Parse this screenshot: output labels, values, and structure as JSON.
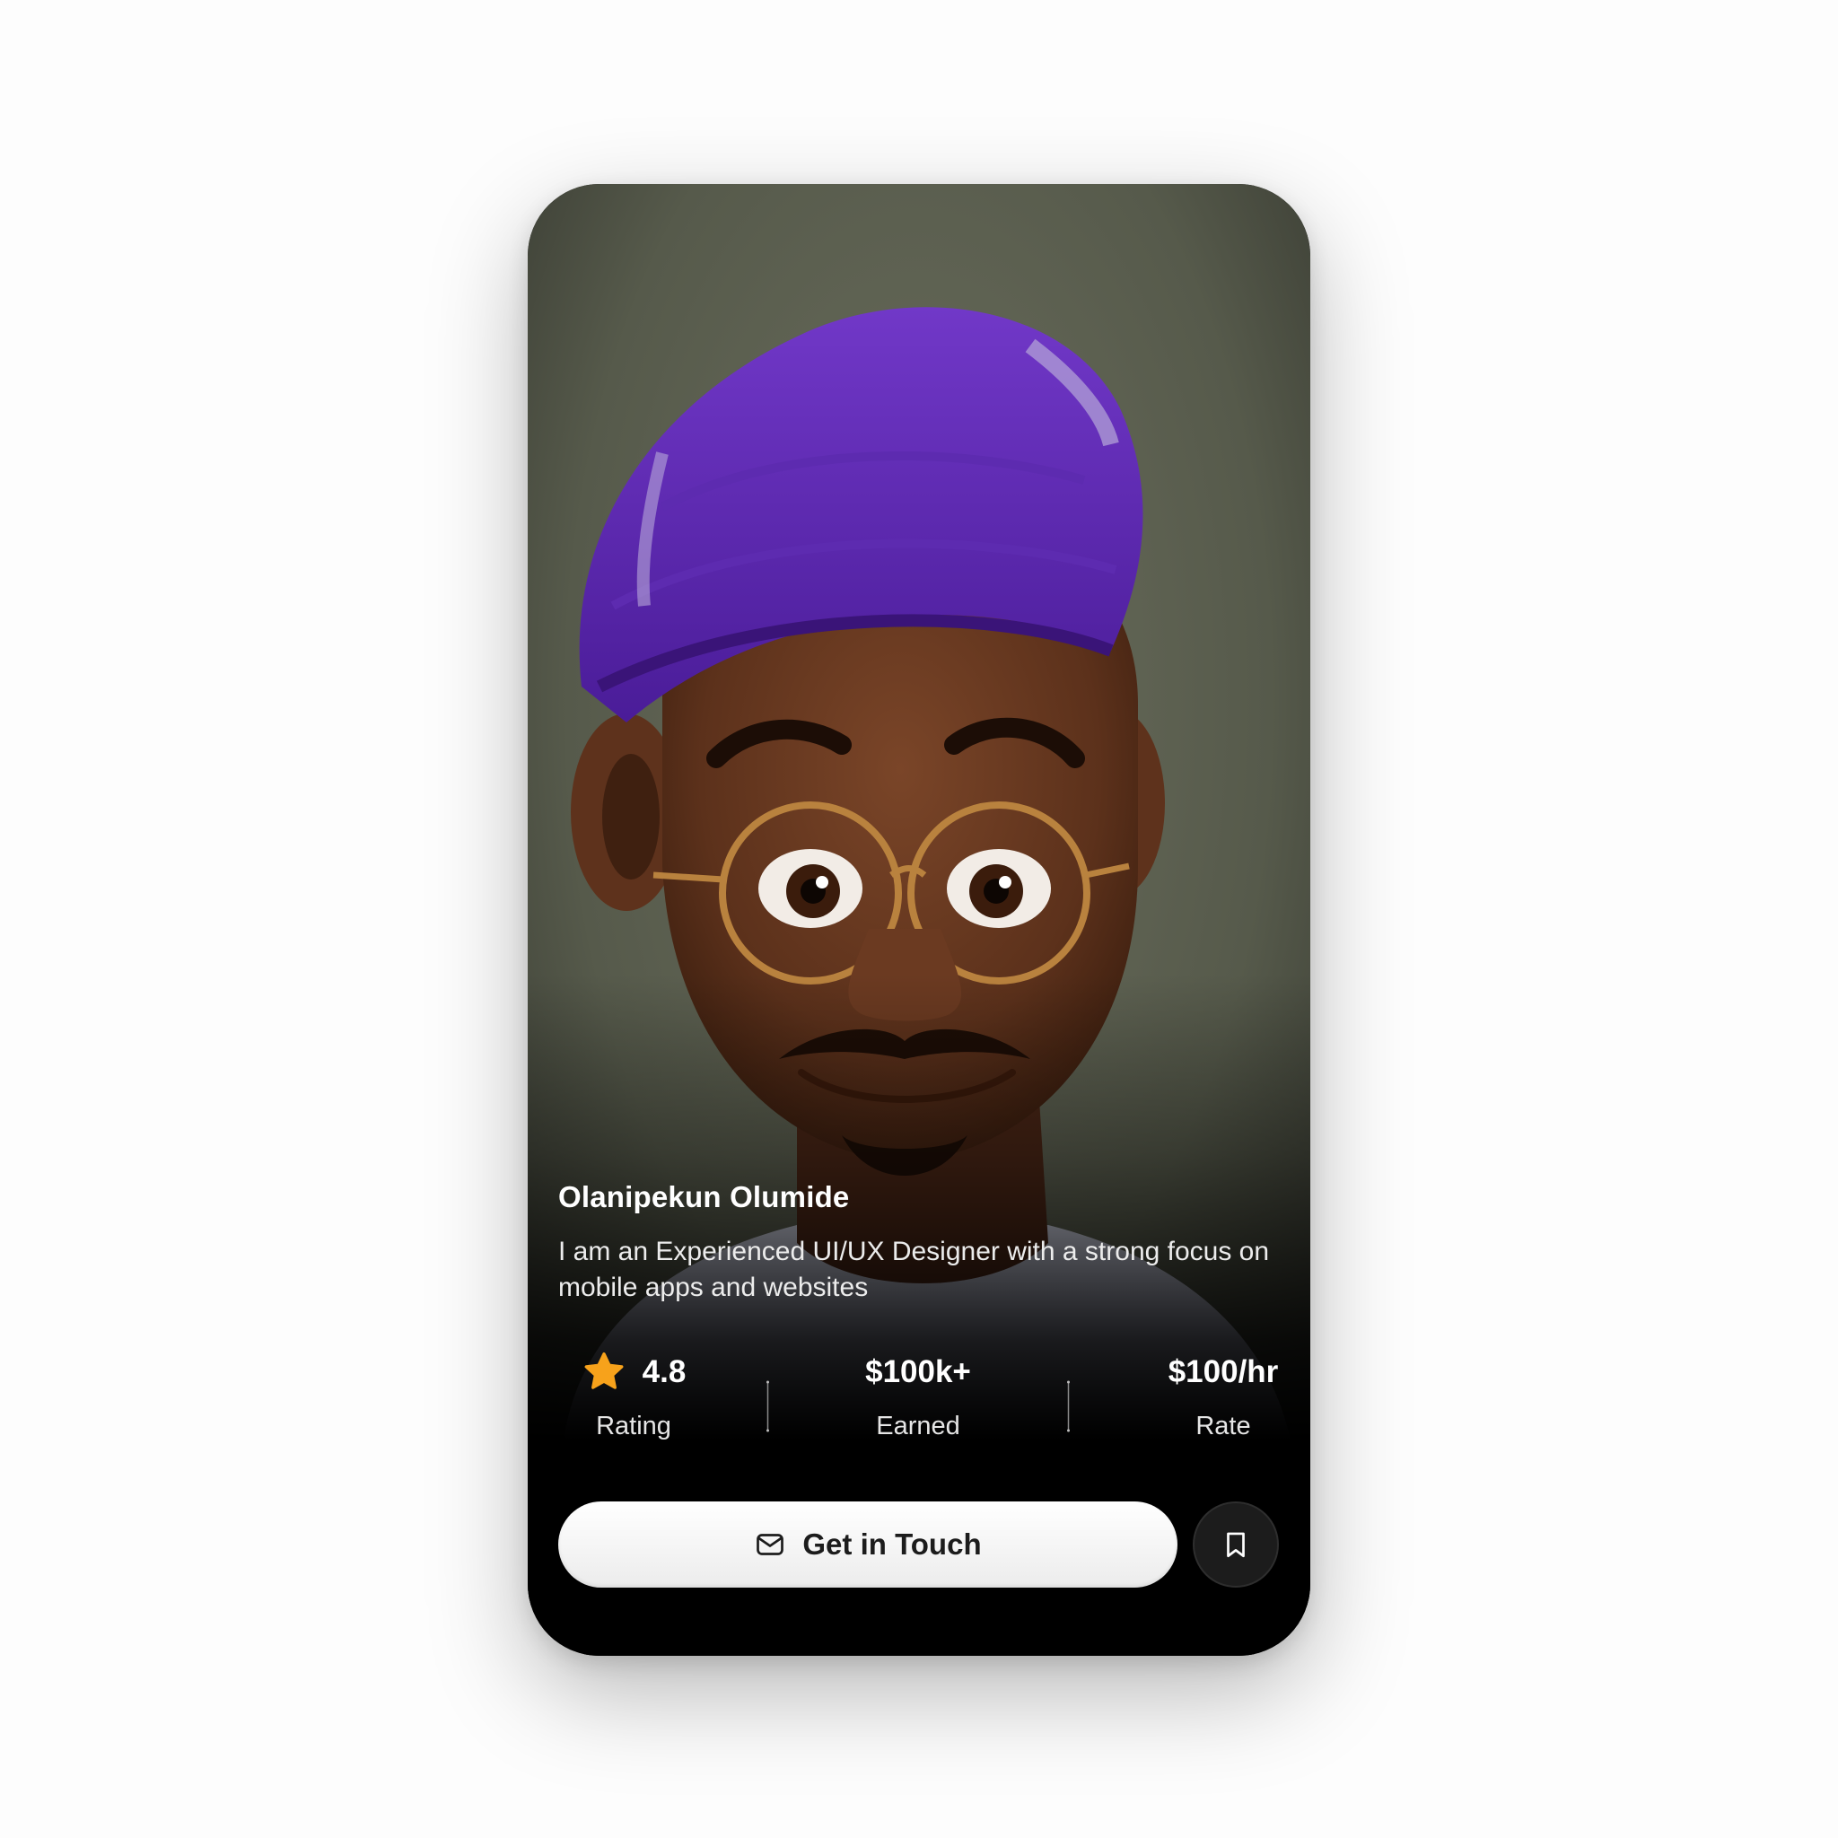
{
  "profile": {
    "name": "Olanipekun Olumide",
    "bio": "I am an Experienced UI/UX Designer with a strong focus on mobile apps and websites",
    "photo_alt": "Portrait of Olanipekun Olumide"
  },
  "stats": {
    "rating": {
      "value": "4.8",
      "label": "Rating",
      "icon": "star-icon"
    },
    "earned": {
      "value": "$100k+",
      "label": "Earned"
    },
    "rate": {
      "value": "$100/hr",
      "label": "Rate"
    }
  },
  "actions": {
    "contact_label": "Get in Touch",
    "contact_icon": "mail-icon",
    "bookmark_icon": "bookmark-icon"
  },
  "colors": {
    "accent_star": "#f7a21b",
    "card_background": "#000000",
    "button_background": "#f4f4f4"
  }
}
